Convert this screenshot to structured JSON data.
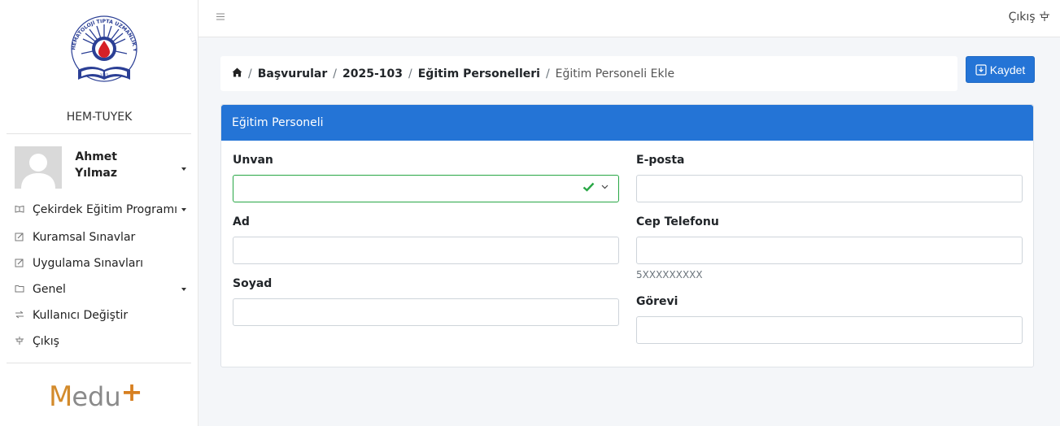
{
  "sidebar": {
    "brand_name": "HEM-TUYEK",
    "logo_text": "HEMATOLOJİ TIPTA UZMANLIK YETERLİK KURULU",
    "user": {
      "first_name": "Ahmet",
      "last_name": "Yılmaz"
    },
    "items": [
      {
        "label": "Çekirdek Eğitim Programı",
        "icon": "book-icon",
        "has_caret": true
      },
      {
        "label": "Kuramsal Sınavlar",
        "icon": "edit-icon",
        "has_caret": false
      },
      {
        "label": "Uygulama Sınavları",
        "icon": "edit-icon",
        "has_caret": false
      },
      {
        "label": "Genel",
        "icon": "folder-icon",
        "has_caret": true
      },
      {
        "label": "Kullanıcı Değiştir",
        "icon": "swap-icon",
        "has_caret": false
      },
      {
        "label": "Çıkış",
        "icon": "logout-icon",
        "has_caret": false
      }
    ],
    "footer_logo": {
      "m": "M",
      "rest": "edu",
      "plus": "+"
    }
  },
  "topbar": {
    "logout_label": "Çıkış"
  },
  "breadcrumb": {
    "items": [
      "Başvurular",
      "2025-103",
      "Eğitim Personelleri"
    ],
    "active": "Eğitim Personeli Ekle"
  },
  "toolbar": {
    "save_label": "Kaydet"
  },
  "form": {
    "title": "Eğitim Personeli",
    "fields": {
      "unvan": {
        "label": "Unvan",
        "value": ""
      },
      "ad": {
        "label": "Ad",
        "value": ""
      },
      "soyad": {
        "label": "Soyad",
        "value": ""
      },
      "eposta": {
        "label": "E-posta",
        "value": ""
      },
      "cep": {
        "label": "Cep Telefonu",
        "value": "",
        "hint": "5XXXXXXXXX"
      },
      "gorevi": {
        "label": "Görevi",
        "value": ""
      }
    }
  },
  "colors": {
    "primary": "#2474d6",
    "valid": "#28a745",
    "brand_orange": "#d38b2c"
  }
}
